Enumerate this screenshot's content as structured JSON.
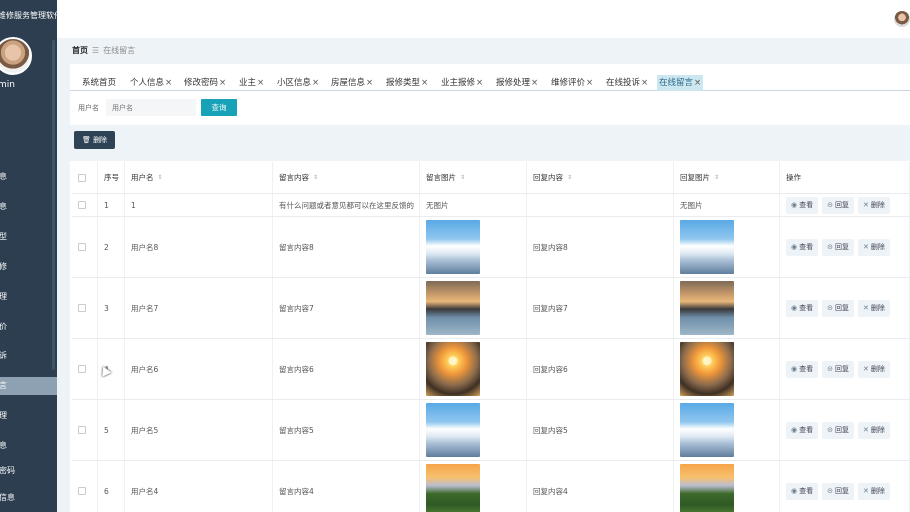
{
  "app": {
    "title": "维修服务管理软件",
    "admin_label": "min"
  },
  "sidebar": {
    "items": [
      {
        "label": "息"
      },
      {
        "label": "息"
      },
      {
        "label": "型"
      },
      {
        "label": "修"
      },
      {
        "label": "理"
      },
      {
        "label": "价"
      },
      {
        "label": "诉"
      },
      {
        "label": "言"
      },
      {
        "label": "理"
      },
      {
        "label": "息"
      },
      {
        "label": "密码"
      },
      {
        "label": "信息"
      }
    ]
  },
  "breadcrumb": {
    "home": "首页",
    "current": "在线留言"
  },
  "tabs": [
    {
      "label": "系统首页",
      "closable": false
    },
    {
      "label": "个人信息",
      "closable": true
    },
    {
      "label": "修改密码",
      "closable": true
    },
    {
      "label": "业主",
      "closable": true
    },
    {
      "label": "小区信息",
      "closable": true
    },
    {
      "label": "房屋信息",
      "closable": true
    },
    {
      "label": "报修类型",
      "closable": true
    },
    {
      "label": "业主报修",
      "closable": true
    },
    {
      "label": "报修处理",
      "closable": true
    },
    {
      "label": "维修评价",
      "closable": true
    },
    {
      "label": "在线投诉",
      "closable": true
    },
    {
      "label": "在线留言",
      "closable": true
    }
  ],
  "filter": {
    "label": "用户名",
    "placeholder": "用户名",
    "query_label": "查询"
  },
  "toolbar": {
    "delete_label": "删除"
  },
  "table": {
    "headers": {
      "index": "序号",
      "username": "用户名",
      "content": "留言内容",
      "image": "留言图片",
      "reply": "回复内容",
      "reply_image": "回复图片",
      "ops": "操作"
    },
    "no_image": "无图片",
    "op_view": "查看",
    "op_reply": "回复",
    "op_delete": "删除",
    "rows": [
      {
        "index": "1",
        "username": "1",
        "content": "有什么问题或者意见都可以在这里反馈的",
        "image": "none",
        "reply": "",
        "reply_image": "none"
      },
      {
        "index": "2",
        "username": "用户名8",
        "content": "留言内容8",
        "image": "snow",
        "reply": "回复内容8",
        "reply_image": "snow"
      },
      {
        "index": "3",
        "username": "用户名7",
        "content": "留言内容7",
        "image": "dusk",
        "reply": "回复内容7",
        "reply_image": "dusk"
      },
      {
        "index": "4",
        "username": "用户名6",
        "content": "留言内容6",
        "image": "sunset",
        "reply": "回复内容6",
        "reply_image": "sunset"
      },
      {
        "index": "5",
        "username": "用户名5",
        "content": "留言内容5",
        "image": "snow",
        "reply": "回复内容5",
        "reply_image": "snow"
      },
      {
        "index": "6",
        "username": "用户名4",
        "content": "留言内容4",
        "image": "field",
        "reply": "回复内容4",
        "reply_image": "field"
      }
    ]
  }
}
